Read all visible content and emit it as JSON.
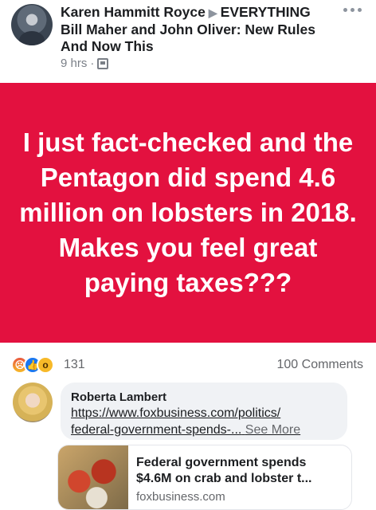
{
  "post": {
    "author": "Karen Hammitt Royce",
    "arrow": "▶",
    "group": "EVERYTHING",
    "group_line2": "Bill Maher and John Oliver: New Rules",
    "group_line3": "And Now This",
    "time": "9 hrs",
    "separator": "·",
    "audience_icon": "group-audience-icon",
    "more_icon": "more-dots-icon"
  },
  "banner": {
    "background": "#e3113f",
    "text": "I just fact-checked and the Pentagon did spend 4.6 million on lobsters in 2018. Makes you feel great paying taxes???"
  },
  "reactions": {
    "icons": [
      "angry",
      "like",
      "wow"
    ],
    "count": "131",
    "comments": "100 Comments"
  },
  "comment": {
    "author": "Roberta Lambert",
    "link_line1": "https://www.foxbusiness.com/politics/",
    "link_line2": "federal-government-spends-...",
    "see_more": "See More"
  },
  "link_preview": {
    "title": "Federal government spends $4.6M on crab and lobster t...",
    "domain": "foxbusiness.com"
  }
}
